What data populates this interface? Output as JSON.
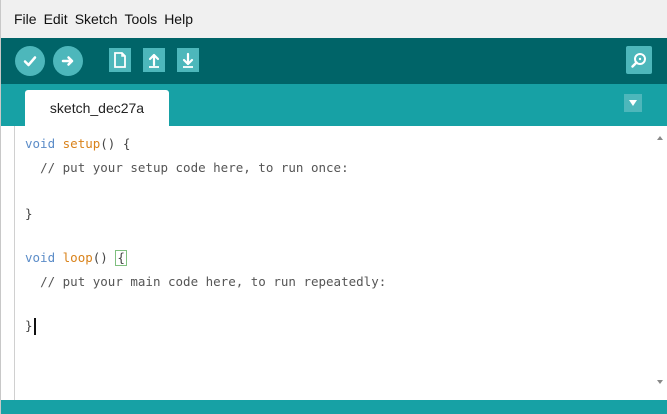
{
  "menu": {
    "items": [
      "File",
      "Edit",
      "Sketch",
      "Tools",
      "Help"
    ]
  },
  "toolbar": {
    "verify_icon": "check-icon",
    "upload_icon": "arrow-right-icon",
    "new_icon": "file-icon",
    "open_icon": "arrow-up-icon",
    "save_icon": "arrow-down-icon",
    "serial_icon": "magnifier-icon",
    "colors": {
      "bar": "#006468",
      "button": "#4db7bb"
    }
  },
  "tabs": {
    "active_label": "sketch_dec27a",
    "menu_icon": "triangle-down-icon"
  },
  "editor": {
    "lines": {
      "setup_kw": "void",
      "setup_fn": "setup",
      "setup_rest": "() {",
      "setup_comment": "// put your setup code here, to run once:",
      "setup_close": "}",
      "loop_kw": "void",
      "loop_fn": "loop",
      "loop_rest": "() ",
      "loop_open": "{",
      "loop_comment": "// put your main code here, to run repeatedly:",
      "loop_close": "}"
    }
  }
}
